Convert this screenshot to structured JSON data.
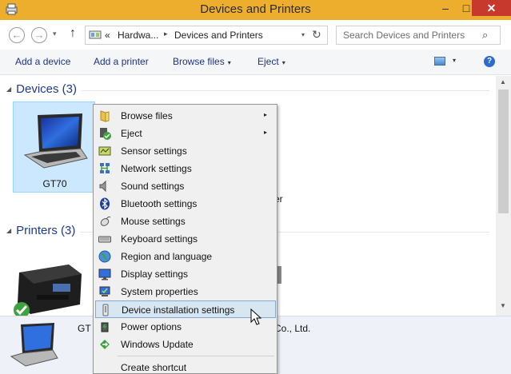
{
  "window": {
    "title": "Devices and Printers",
    "min_glyph": "–",
    "max_glyph": "□",
    "close_glyph": "✕"
  },
  "nav": {
    "back_glyph": "←",
    "forward_glyph": "→",
    "history_glyph": "▾",
    "up_glyph": "↑"
  },
  "address": {
    "overflow": "«",
    "crumbs": [
      "Hardwa...",
      "Devices and Printers"
    ],
    "separator": "▸",
    "dropdown_glyph": "▾",
    "refresh_glyph": "↻"
  },
  "search": {
    "placeholder": "Search Devices and Printers",
    "icon_glyph": "⌕"
  },
  "commandbar": {
    "add_device": "Add a device",
    "add_printer": "Add a printer",
    "browse_files": "Browse files",
    "eject": "Eject",
    "dropdown_glyph": "▾",
    "help_glyph": "?"
  },
  "groups": {
    "devices": {
      "label": "Devices (3)",
      "collapse_glyph": "◢"
    },
    "printers": {
      "label": "Printers (3)",
      "collapse_glyph": "◢"
    }
  },
  "devices": [
    {
      "label": "GT70"
    }
  ],
  "partial_texts": {
    "device_fragment": "er",
    "details_fragment": "GT",
    "details_company": "Co., Ltd."
  },
  "scrollbar": {
    "up_glyph": "▲",
    "down_glyph": "▼"
  },
  "context_menu": {
    "items": [
      {
        "label": "Browse files",
        "icon": "folder-icon",
        "submenu": true
      },
      {
        "label": "Eject",
        "icon": "eject-icon",
        "submenu": true
      },
      {
        "label": "Sensor settings",
        "icon": "sensor-icon",
        "submenu": false
      },
      {
        "label": "Network settings",
        "icon": "network-icon",
        "submenu": false
      },
      {
        "label": "Sound settings",
        "icon": "speaker-icon",
        "submenu": false
      },
      {
        "label": "Bluetooth settings",
        "icon": "bluetooth-icon",
        "submenu": false
      },
      {
        "label": "Mouse settings",
        "icon": "mouse-icon",
        "submenu": false
      },
      {
        "label": "Keyboard settings",
        "icon": "keyboard-icon",
        "submenu": false
      },
      {
        "label": "Region and language",
        "icon": "globe-icon",
        "submenu": false
      },
      {
        "label": "Display settings",
        "icon": "monitor-icon",
        "submenu": false
      },
      {
        "label": "System properties",
        "icon": "system-icon",
        "submenu": false
      },
      {
        "label": "Device installation settings",
        "icon": "device-install-icon",
        "submenu": false,
        "highlighted": true
      },
      {
        "label": "Power options",
        "icon": "power-icon",
        "submenu": false
      },
      {
        "label": "Windows Update",
        "icon": "windows-update-icon",
        "submenu": false
      },
      {
        "label": "Create shortcut",
        "icon": "",
        "submenu": false
      }
    ],
    "submenu_glyph": "▸"
  },
  "colors": {
    "titlebar": "#eeae2d",
    "close": "#c7382d",
    "link": "#1e3287",
    "group_header": "#1e3a8a",
    "selection": "#cce8ff"
  }
}
